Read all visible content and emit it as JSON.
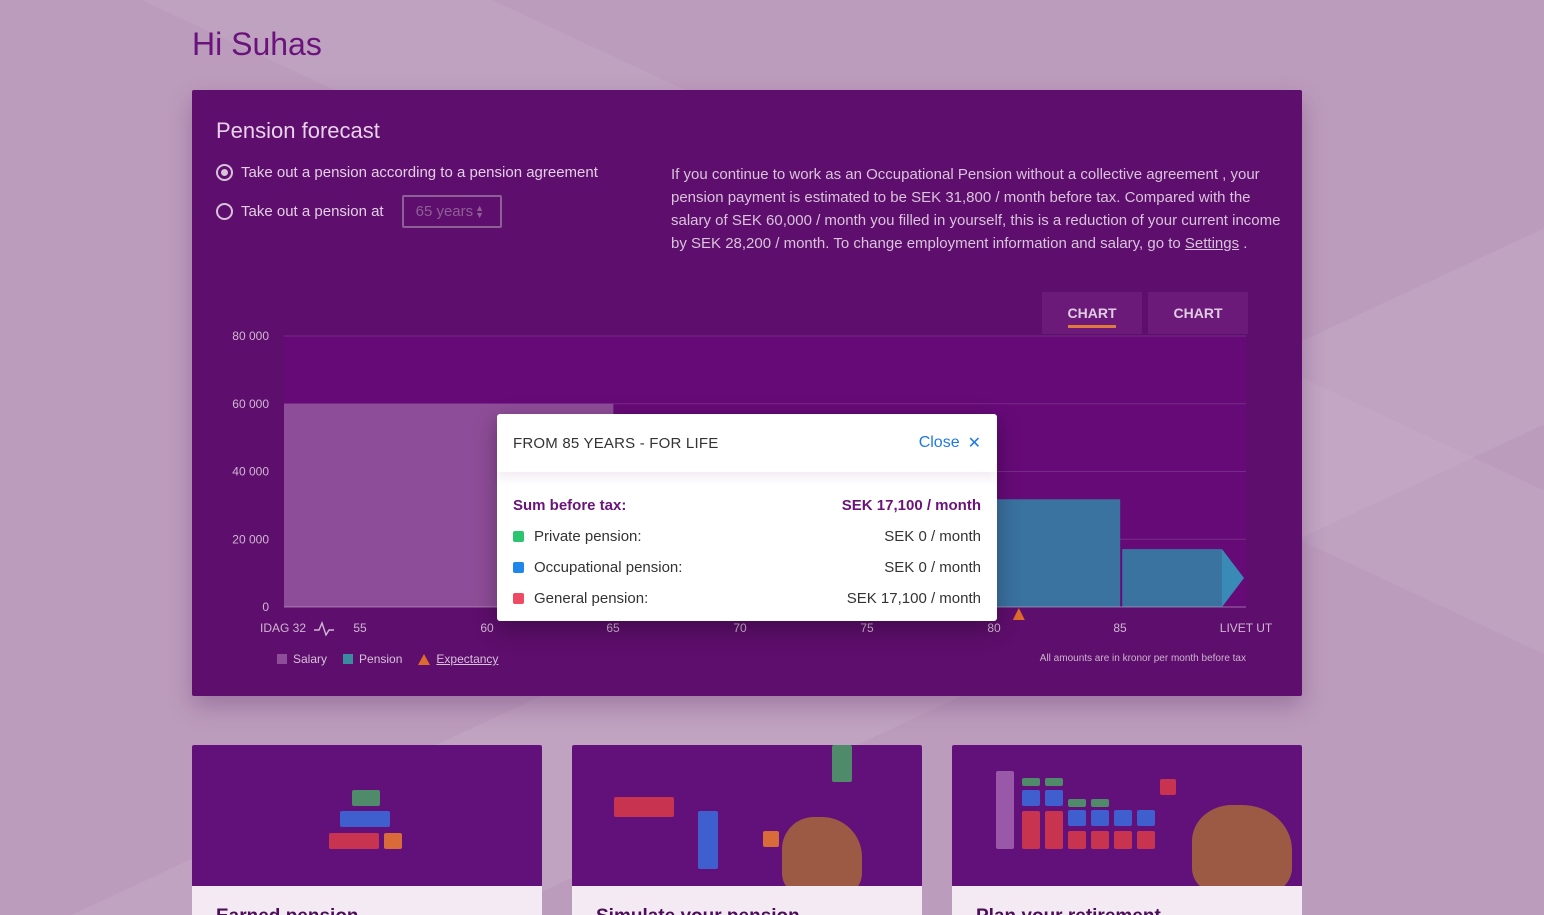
{
  "greeting": "Hi Suhas",
  "forecast": {
    "title": "Pension forecast",
    "option_agreement": "Take out a pension according to a pension agreement",
    "option_age": "Take out a pension at",
    "age_select_value": "65 years",
    "info_text_before": "If you continue to work as an Occupational Pension without a collective agreement , your pension payment is estimated to be SEK 31,800 / month before tax. Compared with the salary of SEK 60,000 / month you filled in yourself, this is a reduction of your current income by SEK 28,200 / month. To change employment information and salary, go to ",
    "info_link": "Settings",
    "info_text_after": " .",
    "tabs": [
      "CHART",
      "CHART"
    ],
    "legend": {
      "salary": "Salary",
      "pension": "Pension",
      "expectancy": "Expectancy"
    },
    "note": "All amounts are in kronor per month before tax",
    "colors": {
      "card": "#5e0e6c",
      "salary": "#8e4d98",
      "pension": "#3a72a0",
      "expectancy": "#dd6b2c"
    }
  },
  "chart_data": {
    "type": "bar",
    "y_ticks": [
      "80 000",
      "60 000",
      "40 000",
      "20 000",
      "0"
    ],
    "ylim": [
      0,
      80000
    ],
    "x_ticks": [
      "IDAG 32",
      "55",
      "60",
      "65",
      "70",
      "75",
      "80",
      "85",
      "LIVET UT"
    ],
    "series": [
      {
        "name": "Salary",
        "segments": [
          {
            "from_age": 32,
            "to_age": 65,
            "value": 60000
          }
        ]
      },
      {
        "name": "Pension",
        "segments": [
          {
            "from_age": 80,
            "to_age": 85,
            "value": 31800
          },
          {
            "from_age": 85,
            "to_age": "LIVET UT",
            "value": 17100
          }
        ]
      }
    ],
    "expectancy_age": 81
  },
  "popup": {
    "title": "FROM 85 YEARS - FOR LIFE",
    "close": "Close",
    "sum_label": "Sum before tax:",
    "sum_value": "SEK 17,100 / month",
    "rows": [
      {
        "label": "Private pension:",
        "value": "SEK 0 / month",
        "color": "#2cc56f"
      },
      {
        "label": "Occupational pension:",
        "value": "SEK 0 / month",
        "color": "#1f86ea"
      },
      {
        "label": "General pension:",
        "value": "SEK 17,100 / month",
        "color": "#ef4a63"
      }
    ]
  },
  "cards": [
    {
      "title": "Earned pension"
    },
    {
      "title": "Simulate your pension"
    },
    {
      "title": "Plan your retirement"
    }
  ]
}
